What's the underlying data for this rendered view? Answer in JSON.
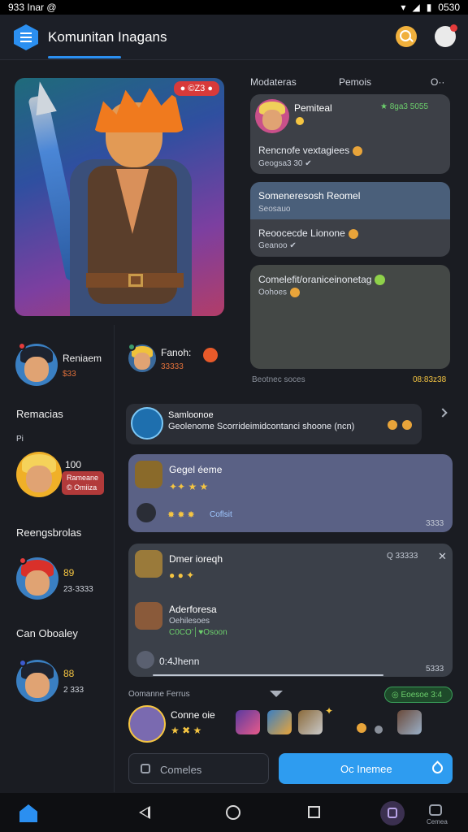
{
  "status": {
    "time_left": "933 Inar",
    "time_right": "0530",
    "left_glyph": "@"
  },
  "header": {
    "title": "Komunitan Inagans"
  },
  "hero": {
    "badge": "● ©Z3 ●"
  },
  "feed_tabs": {
    "tab1": "Modateras",
    "tab2": "Pemois",
    "more": "O··"
  },
  "users": [
    {
      "name": "Reniaem",
      "sub": "$33",
      "sub_color": "#e0703a"
    },
    {
      "name": "Fanoh:",
      "sub": "33333",
      "sub_color": "#e0703a"
    }
  ],
  "sections": {
    "s1": "Remacias",
    "s1_sub": "Pi",
    "s2": "Reengsbrolas",
    "s3": "Can Oboaley"
  },
  "left_list": [
    {
      "top": "100",
      "tag1": "Rameane",
      "tag2": "© Omiiza"
    },
    {
      "top": "89",
      "sub": "23·3333"
    },
    {
      "top": "88",
      "sub": "2 333"
    }
  ],
  "cards": {
    "c1_name": "Pemiteal",
    "c1_tag": "★ 8ga3 5055",
    "c1_text": "Rencnofe vextagiees",
    "c1_meta": "Geogsa3 30 ✔",
    "c2_name": "Someneresosh Reomel",
    "c2_sub": "Seosauo",
    "c2_text": "Reoocecde Lionone",
    "c2_meta": "Geanoo ✔",
    "c3_text": "Comelefit/oraniceinonetag",
    "c3_meta": "Oohoes",
    "feed_footer": "Beotnec soces",
    "feed_footer_right": "08:83z38"
  },
  "thread": {
    "name": "Samloonoe",
    "text": "Geolenome Scorrideimidcontanci shoone (ncn)"
  },
  "card4": {
    "name": "Gegel éeme",
    "line2": "Coflsit",
    "time": "3333"
  },
  "card5": {
    "name": "Dmer ioreqh",
    "time": "Q 33333",
    "name2": "Aderforesa",
    "sub2": "Oehilesoes",
    "sub3": "C0CO’│♥Osoon",
    "footer": "0:4Jhenn",
    "time2": "5333"
  },
  "bottom": {
    "label": "Oomanne Ferrus",
    "name": "Conne oie",
    "badge": "◎ Eoesoe 3:4"
  },
  "search": {
    "placeholder": "Comeles"
  },
  "primary_button": {
    "label": "Oc Inemee"
  },
  "nav": {
    "game_label": "Cemea"
  }
}
